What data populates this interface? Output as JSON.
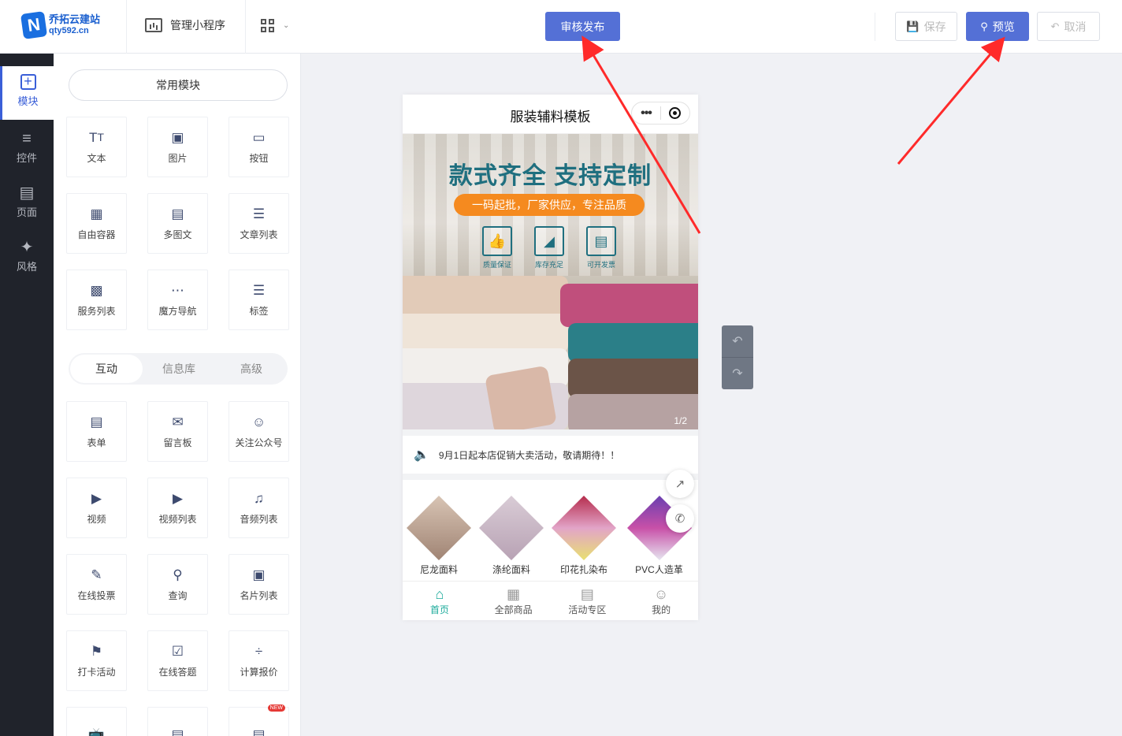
{
  "topbar": {
    "logo_name": "乔拓云建站",
    "logo_url": "qty592.cn",
    "manage_label": "管理小程序",
    "publish_label": "审核发布",
    "save_label": "保存",
    "preview_label": "预览",
    "cancel_label": "取消"
  },
  "rail": {
    "items": [
      {
        "label": "模块",
        "icon": "plus-square-icon"
      },
      {
        "label": "控件",
        "icon": "sliders-icon"
      },
      {
        "label": "页面",
        "icon": "layers-icon"
      },
      {
        "label": "风格",
        "icon": "magic-wand-icon"
      }
    ]
  },
  "panel": {
    "common_label": "常用模块",
    "common_items": [
      "文本",
      "图片",
      "按钮",
      "自由容器",
      "多图文",
      "文章列表",
      "服务列表",
      "魔方导航",
      "标签"
    ],
    "tabs": [
      "互动",
      "信息库",
      "高级"
    ],
    "interactive_items": [
      "表单",
      "留言板",
      "关注公众号",
      "视频",
      "视频列表",
      "音频列表",
      "在线投票",
      "查询",
      "名片列表",
      "打卡活动",
      "在线答题",
      "计算报价"
    ],
    "new_badge": "NEW"
  },
  "phone": {
    "title": "服装辅料模板",
    "banner": {
      "headline": "款式齐全  支持定制",
      "pill": "一码起批，厂家供应，专注品质",
      "features": [
        "质量保证",
        "库存充足",
        "可开发票"
      ],
      "indicator": "1/2"
    },
    "notice": "9月1日起本店促销大卖活动，敬请期待！！",
    "categories": [
      "尼龙面料",
      "涤纶面料",
      "印花扎染布",
      "PVC人造革"
    ],
    "tabbar": [
      "首页",
      "全部商品",
      "活动专区",
      "我的"
    ]
  },
  "colors": {
    "accent": "#5470d6",
    "rail_bg": "#20232b",
    "active_blue": "#3a5fd8",
    "annotation_red": "#ff2a2a",
    "tab_active": "#1aaa9a"
  }
}
